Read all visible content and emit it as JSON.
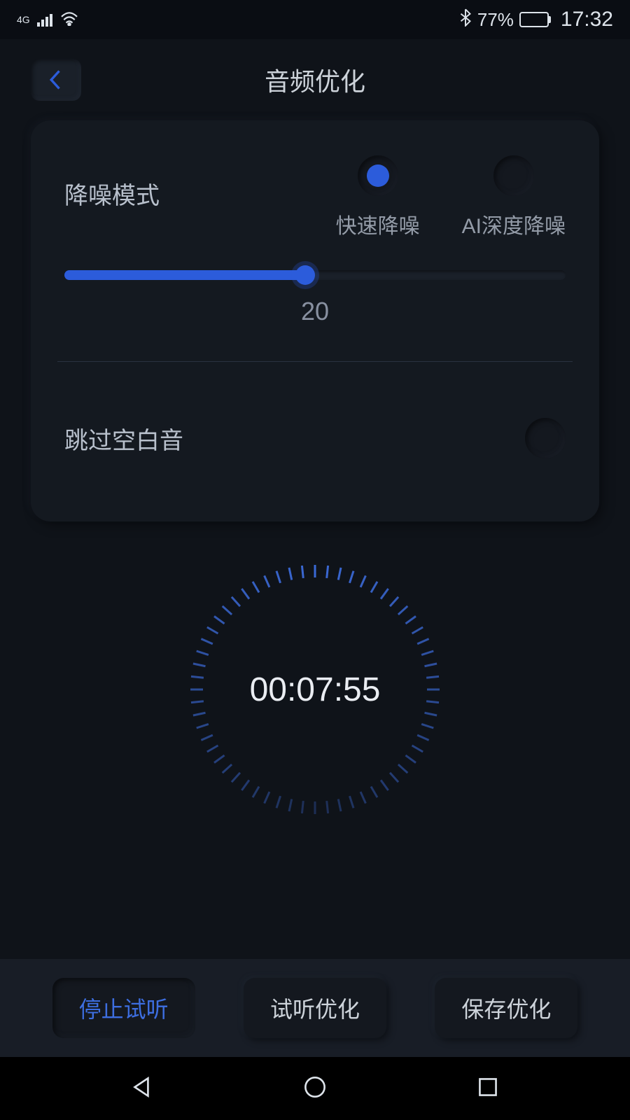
{
  "statusBar": {
    "networkType": "4G",
    "batteryPercent": "77%",
    "time": "17:32"
  },
  "header": {
    "title": "音频优化"
  },
  "settings": {
    "denoise": {
      "label": "降噪模式",
      "option1": "快速降噪",
      "option2": "AI深度降噪",
      "sliderValue": "20",
      "sliderPercent": 48
    },
    "skipSilence": {
      "label": "跳过空白音",
      "enabled": false
    }
  },
  "timer": {
    "display": "00:07:55"
  },
  "actions": {
    "stopPreview": "停止试听",
    "previewOptimize": "试听优化",
    "saveOptimize": "保存优化"
  }
}
